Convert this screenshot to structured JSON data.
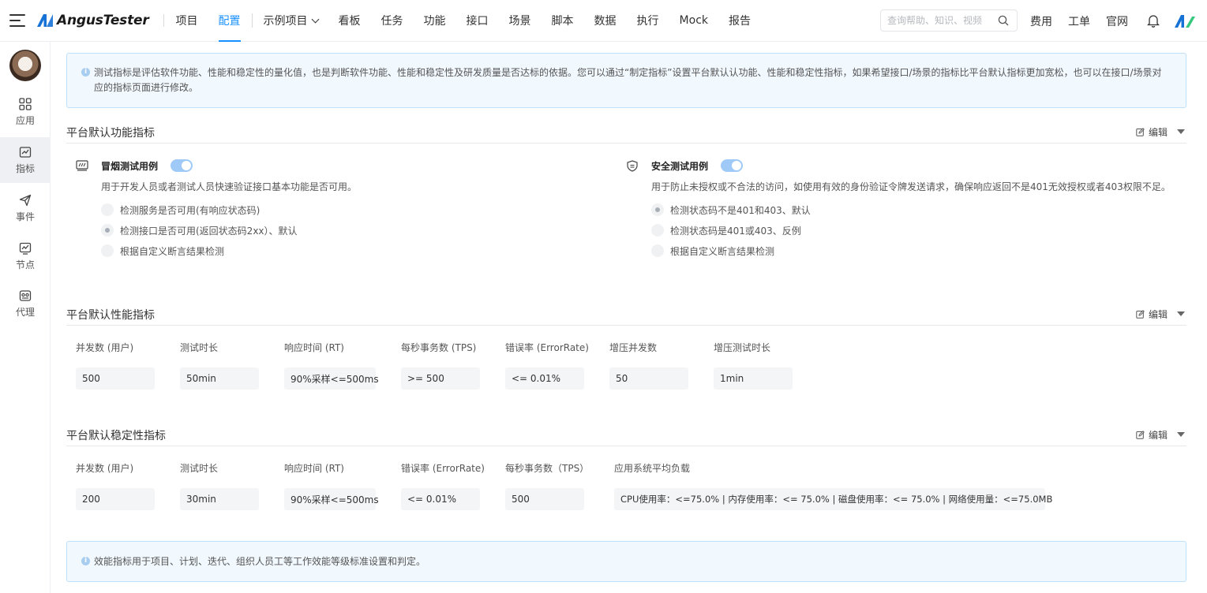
{
  "header": {
    "logo_text": "AngusTester",
    "nav": [
      {
        "label": "项目"
      },
      {
        "label": "配置"
      },
      {
        "label": "示例项目"
      },
      {
        "label": "看板"
      },
      {
        "label": "任务"
      },
      {
        "label": "功能"
      },
      {
        "label": "接口"
      },
      {
        "label": "场景"
      },
      {
        "label": "脚本"
      },
      {
        "label": "数据"
      },
      {
        "label": "执行"
      },
      {
        "label": "Mock"
      },
      {
        "label": "报告"
      }
    ],
    "search_placeholder": "查询帮助、知识、视频",
    "links": [
      "费用",
      "工单",
      "官网"
    ],
    "brand_color": "#1890ff"
  },
  "sidebar": {
    "items": [
      {
        "label": "应用",
        "icon": "apps-grid-icon"
      },
      {
        "label": "指标",
        "icon": "chart-icon"
      },
      {
        "label": "事件",
        "icon": "send-icon"
      },
      {
        "label": "节点",
        "icon": "monitor-chart-icon"
      },
      {
        "label": "代理",
        "icon": "agent-icon"
      }
    ]
  },
  "intro_notice": "测试指标是评估软件功能、性能和稳定性的量化值，也是判断软件功能、性能和稳定性及研发质量是否达标的依据。您可以通过“制定指标”设置平台默认认功能、性能和稳定性指标，如果希望接口/场景的指标比平台默认指标更加宽松，也可以在接口/场景对应的指标页面进行修改。",
  "func_section": {
    "title": "平台默认功能指标",
    "edit_label": "编辑",
    "smoke": {
      "title": "冒烟测试用例",
      "enabled": true,
      "desc": "用于开发人员或者测试人员快速验证接口基本功能是否可用。",
      "options": [
        {
          "label": "检测服务是否可用(有响应状态码)",
          "checked": false
        },
        {
          "label": "检测接口是否可用(返回状态码2xx）、默认",
          "checked": true
        },
        {
          "label": "根据自定义断言结果检测",
          "checked": false
        }
      ]
    },
    "security": {
      "title": "安全测试用例",
      "enabled": true,
      "desc": "用于防止未授权或不合法的访问，如使用有效的身份验证令牌发送请求，确保响应返回不是401无效授权或者403权限不足。",
      "options": [
        {
          "label": "检测状态码不是401和403、默认",
          "checked": true
        },
        {
          "label": "检测状态码是401或403、反例",
          "checked": false
        },
        {
          "label": "根据自定义断言结果检测",
          "checked": false
        }
      ]
    }
  },
  "perf_section": {
    "title": "平台默认性能指标",
    "edit_label": "编辑",
    "metrics": [
      {
        "label": "并发数 (用户)",
        "value": "500"
      },
      {
        "label": "测试时长",
        "value": "50min"
      },
      {
        "label": "响应时间 (RT)",
        "value": "90%采样<=500ms"
      },
      {
        "label": "每秒事务数 (TPS)",
        "value": ">= 500"
      },
      {
        "label": "错误率 (ErrorRate)",
        "value": "<= 0.01%"
      },
      {
        "label": "增压并发数",
        "value": "50"
      },
      {
        "label": "增压测试时长",
        "value": "1min"
      }
    ]
  },
  "stab_section": {
    "title": "平台默认稳定性指标",
    "edit_label": "编辑",
    "metrics": [
      {
        "label": "并发数 (用户)",
        "value": "200"
      },
      {
        "label": "测试时长",
        "value": "30min"
      },
      {
        "label": "响应时间 (RT)",
        "value": "90%采样<=500ms"
      },
      {
        "label": "错误率 (ErrorRate)",
        "value": "<= 0.01%"
      },
      {
        "label": "每秒事务数（TPS）",
        "value": "500"
      },
      {
        "label": "应用系统平均负载",
        "value": "CPU使用率：<=75.0% | 内存使用率：<= 75.0% | 磁盘使用率：<= 75.0% | 网络使用量：<=75.0MB"
      }
    ]
  },
  "efficacy_notice": "效能指标用于项目、计划、迭代、组织人员工等工作效能等级标准设置和判定。"
}
